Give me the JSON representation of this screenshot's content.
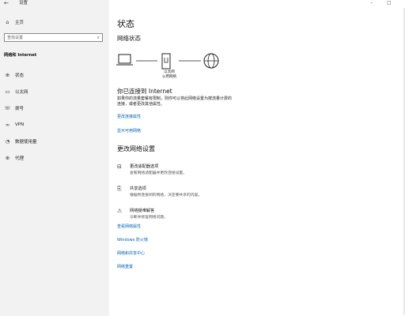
{
  "window": {
    "title": "设置",
    "back": "←",
    "minimize": "–",
    "maximize": "□"
  },
  "sidebar": {
    "home": "主页",
    "search_placeholder": "查找设置",
    "section": "网络和 Internet",
    "items": [
      {
        "label": "状态",
        "icon": "status-icon"
      },
      {
        "label": "以太网",
        "icon": "ethernet-icon"
      },
      {
        "label": "拨号",
        "icon": "dialup-icon"
      },
      {
        "label": "VPN",
        "icon": "vpn-icon"
      },
      {
        "label": "数据使用量",
        "icon": "data-usage-icon"
      },
      {
        "label": "代理",
        "icon": "proxy-icon"
      }
    ]
  },
  "main": {
    "title": "状态",
    "network_status_heading": "网络状态",
    "diagram_label_line1": "以太网",
    "diagram_label_line2": "公用网络",
    "connected_heading": "你已连接到 Internet",
    "connected_desc_line1": "如果你的流量套餐有限制，则你可以将此网络设置为按流量计费的",
    "connected_desc_line2": "连接，或者更改其他属性。",
    "link_change_props": "更改连接属性",
    "link_show_networks": "显示可用网络",
    "change_settings_heading": "更改网络设置",
    "options": [
      {
        "title": "更改适配器选项",
        "desc": "查看网络适配器并更改连接设置。",
        "icon": "adapter-icon"
      },
      {
        "title": "共享选项",
        "desc": "根据所连接到的网络，决定要共享的内容。",
        "icon": "sharing-icon"
      },
      {
        "title": "网络疑难解答",
        "desc": "诊断并修复网络问题。",
        "icon": "warning-icon"
      }
    ],
    "links": [
      "查看网络属性",
      "Windows 防火墙",
      "网络和共享中心",
      "网络重置"
    ]
  },
  "colors": {
    "link": "#0063b1",
    "sidebar_bg": "#f2f2f2"
  }
}
